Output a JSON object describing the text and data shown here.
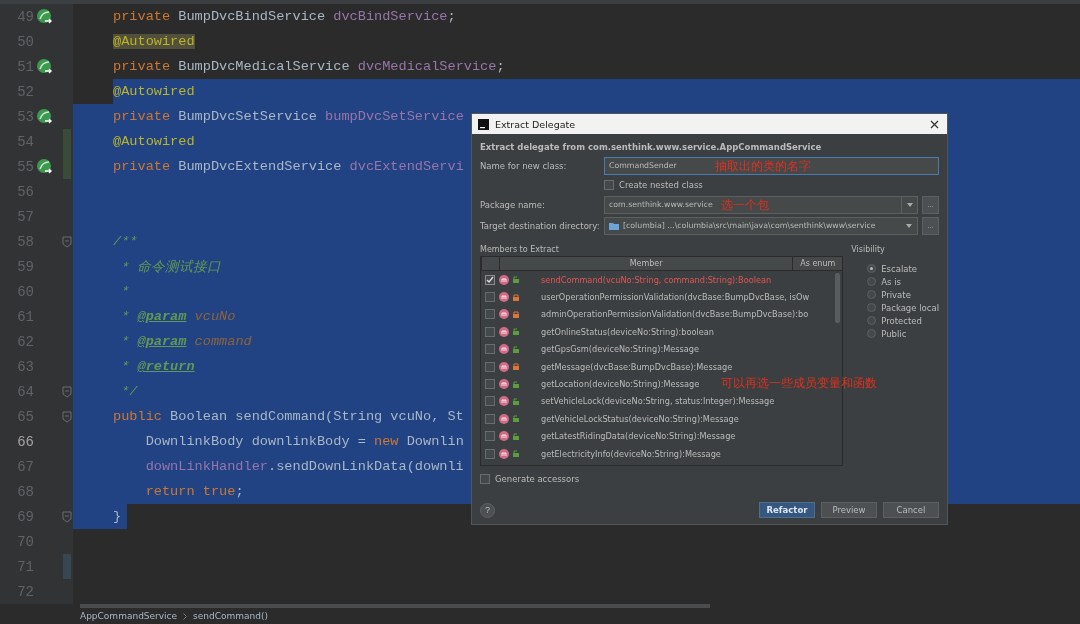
{
  "editor": {
    "lines": [
      {
        "number": "49",
        "bean": true,
        "selected": false,
        "tokens": [
          {
            "kind": "kw",
            "text": "private "
          },
          {
            "kind": "type",
            "text": "BumpDvcBindService "
          },
          {
            "kind": "field",
            "text": "dvcBindService"
          },
          {
            "kind": "plain",
            "text": ";"
          }
        ]
      },
      {
        "number": "50",
        "selected": false,
        "tokens": [
          {
            "kind": "ann",
            "text": "@Autowired",
            "marked": true
          }
        ]
      },
      {
        "number": "51",
        "bean": true,
        "selected": false,
        "tokens": [
          {
            "kind": "kw",
            "text": "private "
          },
          {
            "kind": "type",
            "text": "BumpDvcMedicalService "
          },
          {
            "kind": "field",
            "text": "dvcMedicalService"
          },
          {
            "kind": "plain",
            "text": ";"
          }
        ]
      },
      {
        "number": "52",
        "selected": true,
        "selection_starts_at_text": true,
        "tokens": [
          {
            "kind": "ann",
            "text": "@Autowired"
          }
        ]
      },
      {
        "number": "53",
        "bean": true,
        "selected": true,
        "tokens": [
          {
            "kind": "kw",
            "text": "private "
          },
          {
            "kind": "type",
            "text": "BumpDvcSetService "
          },
          {
            "kind": "field",
            "text": "bumpDvcSetService"
          }
        ]
      },
      {
        "number": "54",
        "added": true,
        "selected": true,
        "tokens": [
          {
            "kind": "ann",
            "text": "@Autowired"
          }
        ]
      },
      {
        "number": "55",
        "bean": true,
        "added": true,
        "selected": true,
        "tokens": [
          {
            "kind": "kw",
            "text": "private "
          },
          {
            "kind": "type",
            "text": "BumpDvcExtendService "
          },
          {
            "kind": "field",
            "text": "dvcExtendServi"
          }
        ]
      },
      {
        "number": "56",
        "selected": true
      },
      {
        "number": "57",
        "selected": true
      },
      {
        "number": "58",
        "fold": true,
        "selected": true,
        "tokens": [
          {
            "kind": "doc",
            "text": "/**"
          }
        ]
      },
      {
        "number": "59",
        "selected": true,
        "tokens": [
          {
            "kind": "doc",
            "text": " * 命令测试接口"
          }
        ]
      },
      {
        "number": "60",
        "selected": true,
        "tokens": [
          {
            "kind": "doc",
            "text": " *"
          }
        ]
      },
      {
        "number": "61",
        "selected": true,
        "tokens": [
          {
            "kind": "doc",
            "text": " * "
          },
          {
            "kind": "doctag",
            "text": "@param"
          },
          {
            "kind": "docparam",
            "text": " vcuNo"
          }
        ]
      },
      {
        "number": "62",
        "selected": true,
        "tokens": [
          {
            "kind": "doc",
            "text": " * "
          },
          {
            "kind": "doctag",
            "text": "@param"
          },
          {
            "kind": "docparam",
            "text": " command"
          }
        ]
      },
      {
        "number": "63",
        "selected": true,
        "tokens": [
          {
            "kind": "doc",
            "text": " * "
          },
          {
            "kind": "doctag",
            "text": "@return"
          }
        ]
      },
      {
        "number": "64",
        "fold": true,
        "selected": true,
        "tokens": [
          {
            "kind": "doc",
            "text": " */"
          }
        ]
      },
      {
        "number": "65",
        "fold": true,
        "selected": true,
        "tokens": [
          {
            "kind": "kw",
            "text": "public "
          },
          {
            "kind": "type",
            "text": "Boolean sendCommand(String vcuNo, St"
          }
        ]
      },
      {
        "number": "66",
        "current": true,
        "selected": true,
        "tokens": [
          {
            "kind": "type",
            "text": "    DownlinkBody downlinkBody = "
          },
          {
            "kind": "kw",
            "text": "new "
          },
          {
            "kind": "type",
            "text": "Downlin"
          }
        ]
      },
      {
        "number": "67",
        "selected": true,
        "tokens": [
          {
            "kind": "field",
            "text": "    downLinkHandler"
          },
          {
            "kind": "type",
            "text": ".sendDownLinkData(downli"
          }
        ]
      },
      {
        "number": "68",
        "selected": true,
        "tokens": [
          {
            "kind": "kw",
            "text": "    return true"
          },
          {
            "kind": "plain",
            "text": ";"
          }
        ]
      },
      {
        "number": "69",
        "fold": true,
        "selected": true,
        "selection_ends_at_text": true,
        "tokens": [
          {
            "kind": "plain",
            "text": "}"
          }
        ]
      },
      {
        "number": "70",
        "selected": false
      },
      {
        "number": "71",
        "modified": true,
        "selected": false
      },
      {
        "number": "72",
        "selected": false
      }
    ]
  },
  "breadcrumb": [
    "AppCommandService",
    "sendCommand()"
  ],
  "dialog": {
    "title": "Extract Delegate",
    "heading": "Extract delegate from com.senthink.www.service.AppCommandService",
    "name_field": {
      "label": "Name for new class:",
      "value": "CommandSender",
      "note": "抽取出的类的名字"
    },
    "nested": {
      "label": "Create nested class",
      "checked": false
    },
    "package_field": {
      "label": "Package name:",
      "value": "com.senthink.www.service",
      "note": "选一个包",
      "browse": "..."
    },
    "target_field": {
      "label": "Target destination directory:",
      "value": "[columbia] ...\\columbia\\src\\main\\java\\com\\senthink\\www\\service",
      "browse": "..."
    },
    "members": {
      "label": "Members to Extract",
      "columns": [
        "Member",
        "As enum"
      ],
      "note": "可以再选一些成员变量和函数",
      "rows": [
        {
          "text": "sendCommand(vcuNo:String, command:String):Boolean",
          "checked": true,
          "private": false,
          "error": true
        },
        {
          "text": "userOperationPermissionValidation(dvcBase:BumpDvcBase, isOw",
          "checked": false,
          "private": true,
          "error": false
        },
        {
          "text": "adminOperationPermissionValidation(dvcBase:BumpDvcBase):bo",
          "checked": false,
          "private": true,
          "error": false
        },
        {
          "text": "getOnlineStatus(deviceNo:String):boolean",
          "checked": false,
          "private": false,
          "error": false
        },
        {
          "text": "getGpsGsm(deviceNo:String):Message",
          "checked": false,
          "private": false,
          "error": false
        },
        {
          "text": "getMessage(dvcBase:BumpDvcBase):Message",
          "checked": false,
          "private": true,
          "error": false
        },
        {
          "text": "getLocation(deviceNo:String):Message",
          "checked": false,
          "private": false,
          "error": false
        },
        {
          "text": "setVehicleLock(deviceNo:String, status:Integer):Message",
          "checked": false,
          "private": false,
          "error": false
        },
        {
          "text": "getVehicleLockStatus(deviceNo:String):Message",
          "checked": false,
          "private": false,
          "error": false
        },
        {
          "text": "getLatestRidingData(deviceNo:String):Message",
          "checked": false,
          "private": false,
          "error": false
        },
        {
          "text": "getElectricityInfo(deviceNo:String):Message",
          "checked": false,
          "private": false,
          "error": false
        }
      ]
    },
    "visibility": {
      "label": "Visibility",
      "options": [
        {
          "label": "Escalate",
          "selected": true
        },
        {
          "label": "As is",
          "selected": false
        },
        {
          "label": "Private",
          "selected": false
        },
        {
          "label": "Package local",
          "selected": false
        },
        {
          "label": "Protected",
          "selected": false
        },
        {
          "label": "Public",
          "selected": false
        }
      ]
    },
    "generate_accessors": {
      "label": "Generate accessors",
      "checked": false
    },
    "help": "?",
    "buttons": [
      {
        "label": "Refactor",
        "default": true
      },
      {
        "label": "Preview",
        "default": false
      },
      {
        "label": "Cancel",
        "default": false
      }
    ]
  }
}
